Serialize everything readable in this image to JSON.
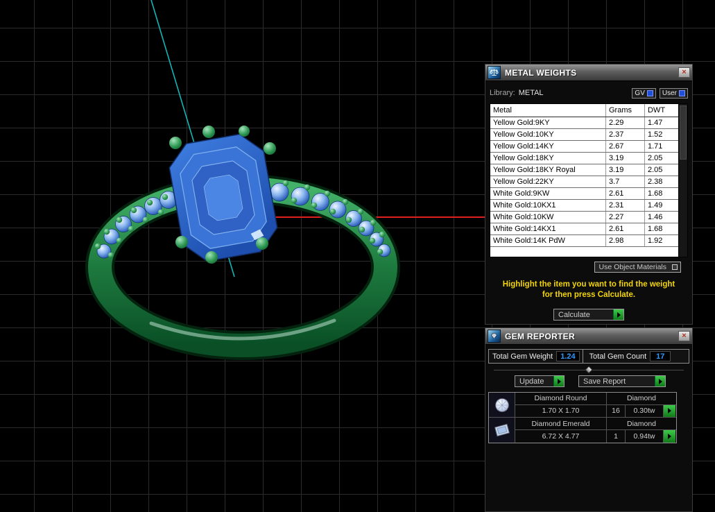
{
  "scene": {
    "colors": {
      "metal": "#1f8a46",
      "gem": "#2e6fd0",
      "axis_x": "#e02020",
      "axis_y": "#12b6b6",
      "grid": "#2c2c2c"
    }
  },
  "metal_weights": {
    "title": "METAL WEIGHTS",
    "close": "×",
    "library_label": "Library:",
    "library_value": "METAL",
    "gv_label": "GV",
    "user_label": "User",
    "columns": {
      "metal": "Metal",
      "grams": "Grams",
      "dwt": "DWT"
    },
    "rows": [
      {
        "metal": "Yellow Gold:9KY",
        "grams": "2.29",
        "dwt": "1.47"
      },
      {
        "metal": "Yellow Gold:10KY",
        "grams": "2.37",
        "dwt": "1.52"
      },
      {
        "metal": "Yellow Gold:14KY",
        "grams": "2.67",
        "dwt": "1.71"
      },
      {
        "metal": "Yellow Gold:18KY",
        "grams": "3.19",
        "dwt": "2.05"
      },
      {
        "metal": "Yellow Gold:18KY Royal",
        "grams": "3.19",
        "dwt": "2.05"
      },
      {
        "metal": "Yellow Gold:22KY",
        "grams": "3.7",
        "dwt": "2.38"
      },
      {
        "metal": "White Gold:9KW",
        "grams": "2.61",
        "dwt": "1.68"
      },
      {
        "metal": "White Gold:10KX1",
        "grams": "2.31",
        "dwt": "1.49"
      },
      {
        "metal": "White Gold:10KW",
        "grams": "2.27",
        "dwt": "1.46"
      },
      {
        "metal": "White Gold:14KX1",
        "grams": "2.61",
        "dwt": "1.68"
      },
      {
        "metal": "White Gold:14K PdW",
        "grams": "2.98",
        "dwt": "1.92"
      }
    ],
    "use_object_materials": "Use Object Materials",
    "instruction_line1": "Highlight the item you want to find the weight",
    "instruction_line2": "for then press Calculate.",
    "calculate": "Calculate"
  },
  "gem_reporter": {
    "title": "GEM REPORTER",
    "close": "×",
    "total_gem_weight_label": "Total Gem Weight",
    "total_gem_weight": "1.24",
    "total_gem_count_label": "Total Gem Count",
    "total_gem_count": "17",
    "update": "Update",
    "save_report": "Save Report",
    "gems": [
      {
        "name": "Diamond Round",
        "type": "Diamond",
        "size": "1.70 X 1.70",
        "count": "16",
        "weight": "0.30tw"
      },
      {
        "name": "Diamond Emerald",
        "type": "Diamond",
        "size": "6.72 X 4.77",
        "count": "1",
        "weight": "0.94tw"
      }
    ]
  }
}
